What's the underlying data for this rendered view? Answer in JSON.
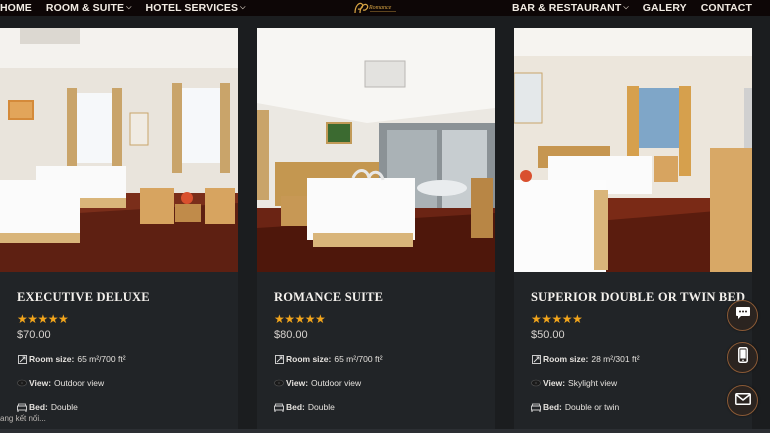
{
  "nav": {
    "left": [
      {
        "label": "HOME",
        "has_dropdown": false
      },
      {
        "label": "ROOM & SUITE",
        "has_dropdown": true
      },
      {
        "label": "HOTEL SERVICES",
        "has_dropdown": true
      }
    ],
    "right": [
      {
        "label": "BAR & RESTAURANT",
        "has_dropdown": true
      },
      {
        "label": "GALERY",
        "has_dropdown": false
      },
      {
        "label": "CONTACT",
        "has_dropdown": false
      }
    ],
    "logo_text": "Romance"
  },
  "rooms": [
    {
      "title": "EXECUTIVE DELUXE",
      "stars": "★★★★★",
      "price": "$70.00",
      "size_label": "Room size:",
      "size_value": "65 m²/700 ft²",
      "view_label": "View:",
      "view_value": "Outdoor view",
      "bed_label": "Bed:",
      "bed_value": "Double"
    },
    {
      "title": "ROMANCE SUITE",
      "stars": "★★★★★",
      "price": "$80.00",
      "size_label": "Room size:",
      "size_value": "65 m²/700 ft²",
      "view_label": "View:",
      "view_value": "Outdoor view",
      "bed_label": "Bed:",
      "bed_value": "Double"
    },
    {
      "title": "SUPERIOR DOUBLE OR TWIN BED",
      "stars": "★★★★★",
      "price": "$50.00",
      "size_label": "Room size:",
      "size_value": "28 m²/301 ft²",
      "view_label": "View:",
      "view_value": "Skylight view",
      "bed_label": "Bed:",
      "bed_value": "Double or twin"
    }
  ],
  "status_text": "ang kết nối...",
  "floating": [
    "chat-icon",
    "phone-icon",
    "mail-icon"
  ],
  "colors": {
    "nav_bg": "#0d0606",
    "page_bg": "#1b1d1f",
    "card_bg": "#212427",
    "star": "#f2a51c",
    "floating_border": "#8a5a36"
  }
}
